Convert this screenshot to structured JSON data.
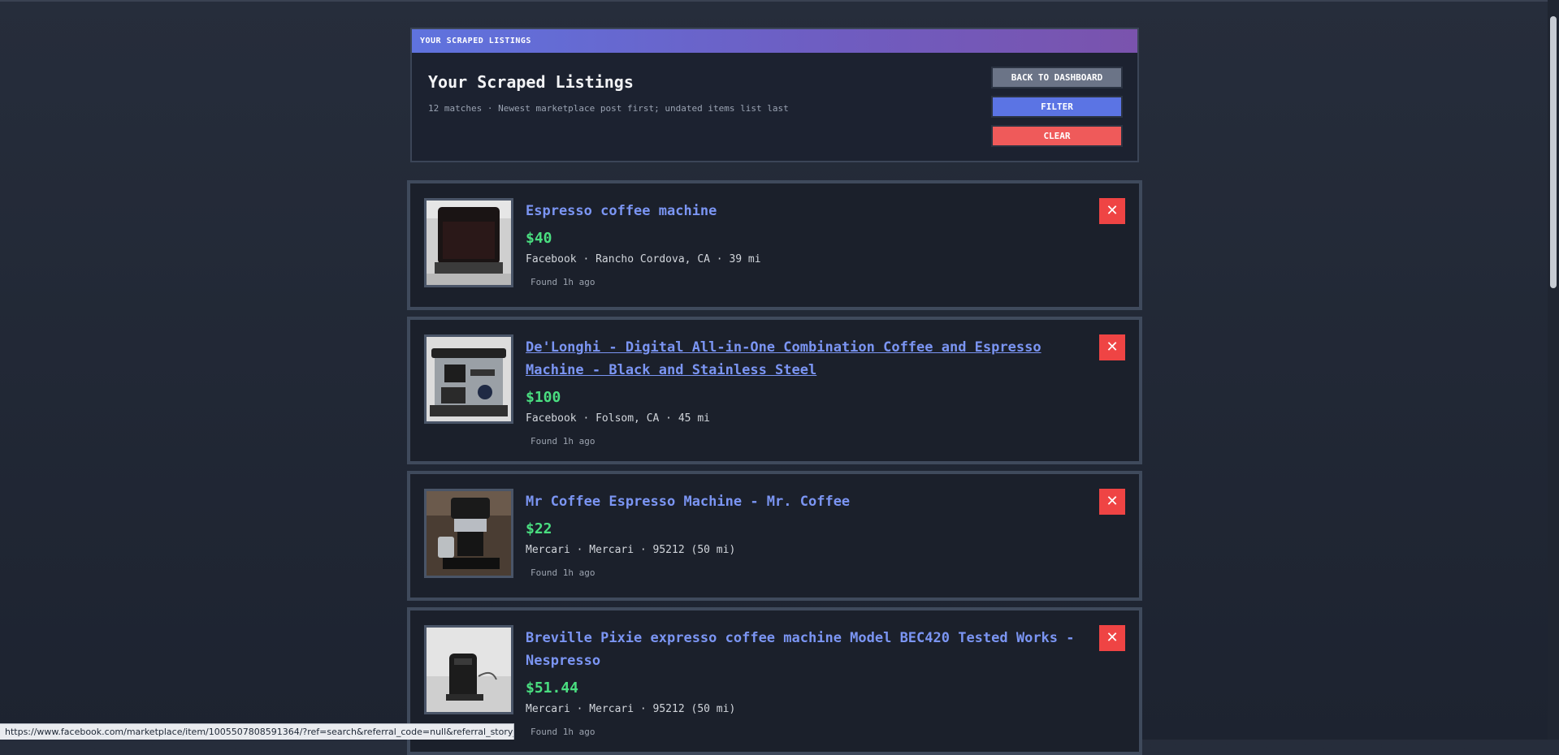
{
  "header": {
    "bar_label": "YOUR SCRAPED LISTINGS",
    "title": "Your Scraped Listings",
    "subtitle": "12 matches · Newest marketplace post first; undated items list last",
    "buttons": {
      "back": "BACK TO DASHBOARD",
      "filter": "FILTER",
      "clear": "CLEAR"
    }
  },
  "listings": [
    {
      "title": "Espresso coffee machine",
      "price": "$40",
      "meta": "Facebook · Rancho Cordova, CA · 39 mi",
      "found": "Found 1h ago",
      "delete_label": "✕"
    },
    {
      "title": "De'Longhi - Digital All-in-One Combination Coffee and Espresso Machine - Black and Stainless Steel",
      "price": "$100",
      "meta": "Facebook · Folsom, CA · 45 mi",
      "found": "Found 1h ago",
      "delete_label": "✕"
    },
    {
      "title": "Mr Coffee Espresso Machine - Mr. Coffee",
      "price": "$22",
      "meta": "Mercari · Mercari · 95212 (50 mi)",
      "found": "Found 1h ago",
      "delete_label": "✕"
    },
    {
      "title": "Breville Pixie expresso coffee machine Model BEC420 Tested Works - Nespresso",
      "price": "$51.44",
      "meta": "Mercari · Mercari · 95212 (50 mi)",
      "found": "Found 1h ago",
      "delete_label": "✕"
    }
  ],
  "status_url": "https://www.facebook.com/marketplace/item/1005507808591364/?ref=search&referral_code=null&referral_story_ty...",
  "colors": {
    "accent": "#5b74e4",
    "price": "#4ade80",
    "danger": "#ef4444",
    "link": "#7b95f3"
  }
}
